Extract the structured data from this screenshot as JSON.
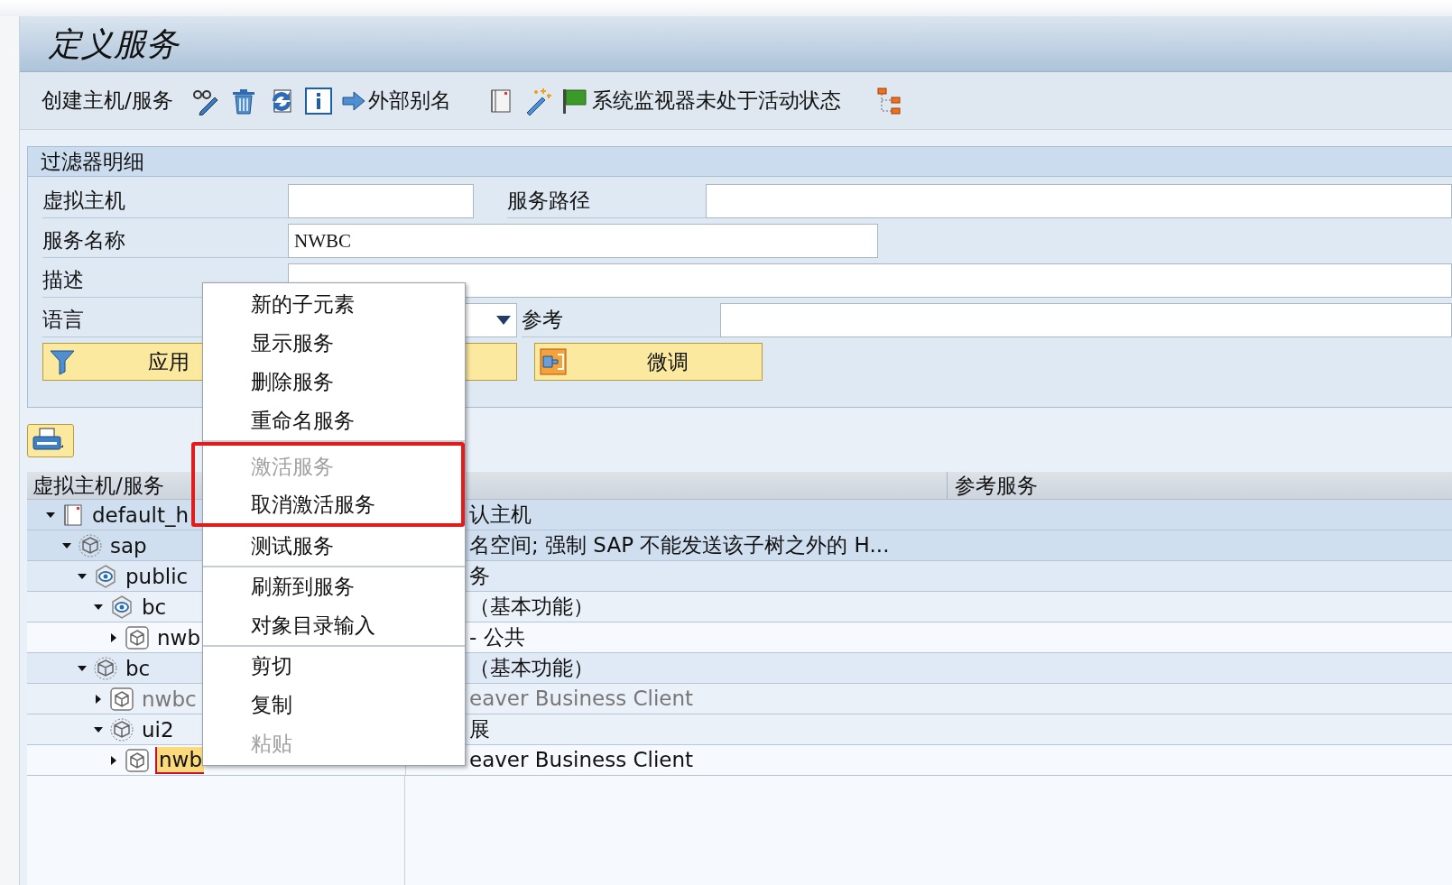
{
  "window": {
    "title": "定义服务"
  },
  "toolbar": {
    "create_label": "创建主机/服务",
    "alias_label": "外部别名",
    "monitor_label": "系统监视器未处于活动状态"
  },
  "filter": {
    "title": "过滤器明细",
    "virtual_host": {
      "label": "虚拟主机"
    },
    "service_path": {
      "label": "服务路径"
    },
    "service_name": {
      "label": "服务名称",
      "value": "NWBC"
    },
    "description": {
      "label": "描述"
    },
    "language": {
      "label": "语言"
    },
    "reference": {
      "label": "参考"
    },
    "apply_button": "应用",
    "tune_button": "微调"
  },
  "table": {
    "columns": [
      "虚拟主机/服务",
      "参考服务"
    ],
    "rows": [
      {
        "label": "default_h",
        "kind": "host",
        "expanded": true,
        "selected": false,
        "inactive": false,
        "description": "认主机",
        "children": [
          {
            "label": "sap",
            "kind": "namespace",
            "expanded": true,
            "selected": false,
            "inactive": false,
            "description": "名空间; 强制 SAP 不能发送该子树之外的 H...",
            "children": [
              {
                "label": "public",
                "kind": "external",
                "expanded": true,
                "selected": false,
                "inactive": false,
                "description": "务",
                "children": [
                  {
                    "label": "bc",
                    "kind": "external",
                    "expanded": true,
                    "selected": false,
                    "inactive": false,
                    "description": "（基本功能）",
                    "children": [
                      {
                        "label": "nwb",
                        "kind": "service",
                        "expanded": false,
                        "selected": false,
                        "inactive": false,
                        "description": "- 公共"
                      }
                    ]
                  }
                ]
              },
              {
                "label": "bc",
                "kind": "namespace",
                "expanded": true,
                "selected": false,
                "inactive": false,
                "description": "（基本功能）",
                "children": [
                  {
                    "label": "nwbc",
                    "kind": "service",
                    "expanded": false,
                    "selected": false,
                    "inactive": true,
                    "description": "eaver Business Client"
                  },
                  {
                    "label": "ui2",
                    "kind": "namespace",
                    "expanded": true,
                    "selected": false,
                    "inactive": false,
                    "description": "展",
                    "children": [
                      {
                        "label": "nwb",
                        "kind": "service",
                        "expanded": false,
                        "selected": true,
                        "inactive": false,
                        "description": "eaver Business Client"
                      }
                    ]
                  }
                ]
              }
            ]
          }
        ]
      }
    ]
  },
  "context_menu": {
    "groups": [
      [
        {
          "label": "新的子元素",
          "disabled": false
        },
        {
          "label": "显示服务",
          "disabled": false
        },
        {
          "label": "删除服务",
          "disabled": false
        },
        {
          "label": "重命名服务",
          "disabled": false
        }
      ],
      [
        {
          "label": "激活服务",
          "disabled": true
        },
        {
          "label": "取消激活服务",
          "disabled": false
        },
        {
          "label": "测试服务",
          "disabled": false
        }
      ],
      [
        {
          "label": "刷新到服务",
          "disabled": false
        },
        {
          "label": "对象目录输入",
          "disabled": false
        }
      ],
      [
        {
          "label": "剪切",
          "disabled": false
        },
        {
          "label": "复制",
          "disabled": false
        },
        {
          "label": "粘贴",
          "disabled": true
        }
      ]
    ]
  }
}
